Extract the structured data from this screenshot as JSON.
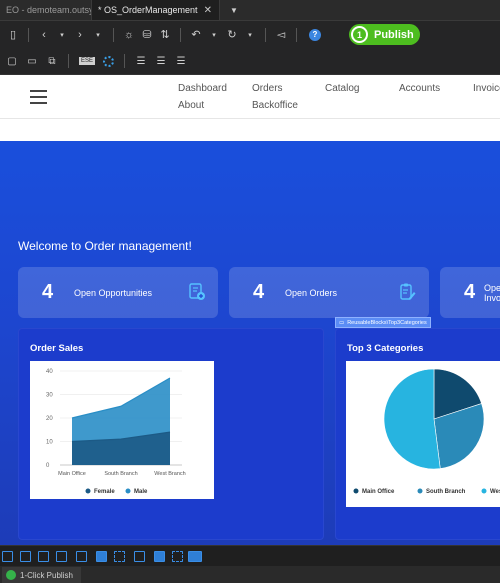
{
  "tabs": [
    {
      "label": "EO - demoteam.outsys",
      "active": false
    },
    {
      "label": "* OS_OrderManagement",
      "active": true
    }
  ],
  "tab_close": "✕",
  "tab_dropdown": "▼",
  "publish": {
    "step": "1",
    "label": "Publish",
    "color": "#4dbd1f"
  },
  "help_glyph": "?",
  "toolbar2_label": "ESE",
  "nav": {
    "row1": [
      "Dashboard",
      "Orders",
      "Catalog",
      "Accounts",
      "Invoices"
    ],
    "row2": [
      "About",
      "Backoffice"
    ]
  },
  "welcome": "Welcome to Order management!",
  "kpis": [
    {
      "value": "4",
      "label": "Open Opportunities",
      "icon": "document-add-icon"
    },
    {
      "value": "4",
      "label": "Open Orders",
      "icon": "document-edit-icon"
    },
    {
      "value": "4",
      "label": "Open Invoices",
      "icon": "document-icon"
    }
  ],
  "tooltip": "ReusableBlocks\\Top3Categories",
  "charts": {
    "sales_title": "Order Sales",
    "top3_title": "Top 3 Categories"
  },
  "chart_data": [
    {
      "type": "area",
      "title": "",
      "categories": [
        "Main Office",
        "South Branch",
        "West Branch"
      ],
      "series": [
        {
          "name": "Female",
          "values": [
            10,
            11,
            14
          ]
        },
        {
          "name": "Male",
          "values": [
            20,
            25,
            37
          ]
        }
      ],
      "ylim": [
        0,
        40
      ],
      "yticks": [
        0,
        10,
        20,
        30,
        40
      ],
      "legend": "bottom",
      "grid": true,
      "colors": {
        "Female": "#1c5a86",
        "Male": "#2a8ec6"
      }
    },
    {
      "type": "pie",
      "title": "",
      "categories": [
        "Main Office",
        "South Branch",
        "West Branch"
      ],
      "values": [
        20,
        28,
        52
      ],
      "legend": "bottom",
      "colors": [
        "#0f4a6e",
        "#2a8ab8",
        "#27b4e0"
      ]
    }
  ],
  "status": {
    "label": "1-Click Publish"
  }
}
